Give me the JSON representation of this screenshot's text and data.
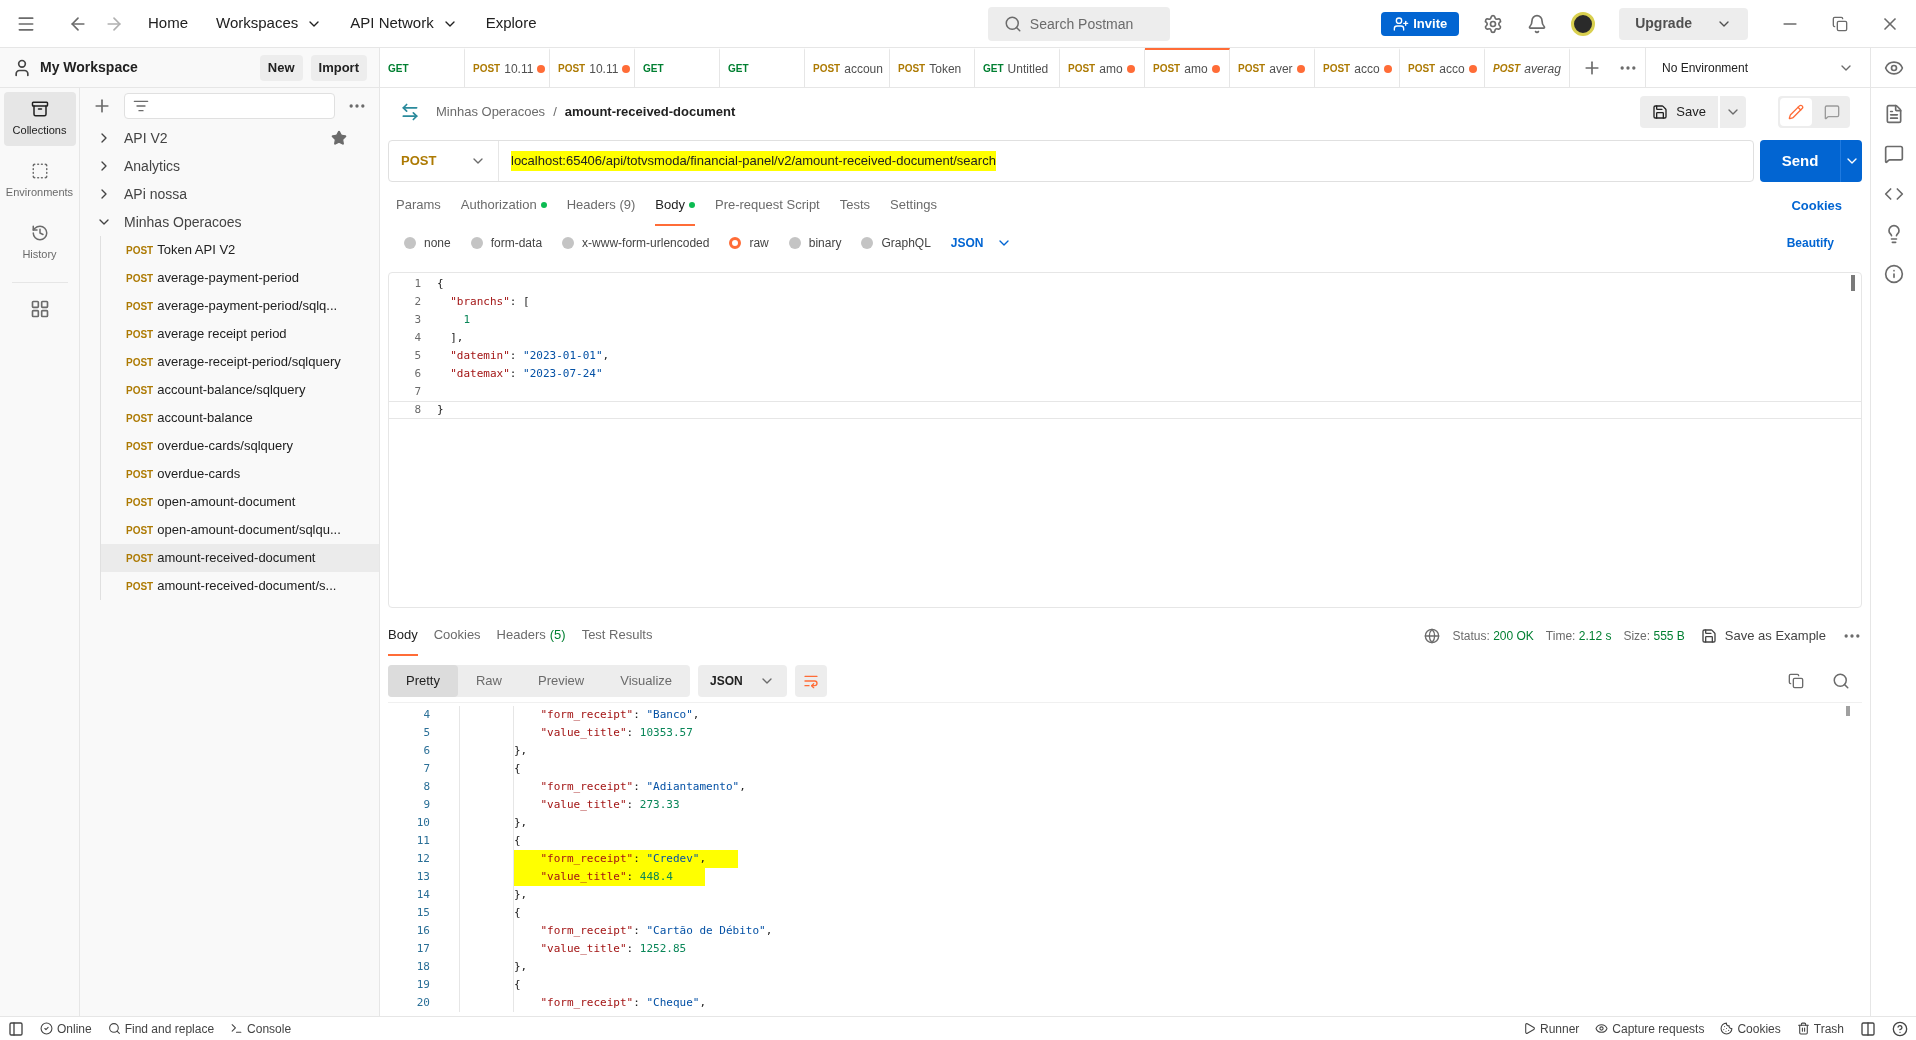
{
  "topbar": {
    "nav": [
      {
        "label": "Home",
        "dropdown": false
      },
      {
        "label": "Workspaces",
        "dropdown": true
      },
      {
        "label": "API Network",
        "dropdown": true
      },
      {
        "label": "Explore",
        "dropdown": false
      }
    ],
    "search": {
      "placeholder": "Search Postman"
    },
    "invite": "Invite",
    "upgrade": "Upgrade"
  },
  "workspace": {
    "title": "My Workspace",
    "buttons": [
      "New",
      "Import"
    ]
  },
  "rail": [
    {
      "label": "Collections",
      "selected": true
    },
    {
      "label": "Environments",
      "selected": false
    },
    {
      "label": "History",
      "selected": false
    }
  ],
  "tree": [
    {
      "name": "API V2",
      "expanded": false,
      "starred": true
    },
    {
      "name": "Analytics",
      "expanded": false,
      "starred": false
    },
    {
      "name": "APi nossa",
      "expanded": false,
      "starred": false
    },
    {
      "name": "Minhas Operacoes",
      "expanded": true,
      "starred": false,
      "children": [
        {
          "method": "POST",
          "name": "Token API V2",
          "selected": false
        },
        {
          "method": "POST",
          "name": "average-payment-period",
          "selected": false
        },
        {
          "method": "POST",
          "name": "average-payment-period/sqlq...",
          "selected": false
        },
        {
          "method": "POST",
          "name": "average receipt period",
          "selected": false
        },
        {
          "method": "POST",
          "name": "average-receipt-period/sqlquery",
          "selected": false
        },
        {
          "method": "POST",
          "name": "account-balance/sqlquery",
          "selected": false
        },
        {
          "method": "POST",
          "name": "account-balance",
          "selected": false
        },
        {
          "method": "POST",
          "name": "overdue-cards/sqlquery",
          "selected": false
        },
        {
          "method": "POST",
          "name": "overdue-cards",
          "selected": false
        },
        {
          "method": "POST",
          "name": "open-amount-document",
          "selected": false
        },
        {
          "method": "POST",
          "name": "open-amount-document/sqlqu...",
          "selected": false
        },
        {
          "method": "POST",
          "name": "amount-received-document",
          "selected": true
        },
        {
          "method": "POST",
          "name": "amount-received-document/s...",
          "selected": false
        }
      ]
    }
  ],
  "tabs": [
    {
      "method": "GET",
      "unsaved": false,
      "selected": false,
      "preview": false
    },
    {
      "method": "POST",
      "name": "10.11",
      "unsaved": true,
      "selected": false,
      "preview": false
    },
    {
      "method": "POST",
      "name": "10.11",
      "unsaved": true,
      "selected": false,
      "preview": false
    },
    {
      "method": "GET",
      "unsaved": false,
      "selected": false,
      "preview": false
    },
    {
      "method": "GET",
      "unsaved": false,
      "selected": false,
      "preview": false
    },
    {
      "method": "POST",
      "name": "accoun",
      "unsaved": false,
      "selected": false,
      "preview": false
    },
    {
      "method": "POST",
      "name": "Token",
      "unsaved": false,
      "selected": false,
      "preview": false
    },
    {
      "method": "GET",
      "name": "Untitled",
      "unsaved": false,
      "selected": false,
      "preview": false
    },
    {
      "method": "POST",
      "name": "amo",
      "unsaved": true,
      "selected": false,
      "preview": false
    },
    {
      "method": "POST",
      "name": "amo",
      "unsaved": true,
      "selected": true,
      "preview": false
    },
    {
      "method": "POST",
      "name": "aver",
      "unsaved": true,
      "selected": false,
      "preview": false
    },
    {
      "method": "POST",
      "name": "acco",
      "unsaved": true,
      "selected": false,
      "preview": false
    },
    {
      "method": "POST",
      "name": "acco",
      "unsaved": true,
      "selected": false,
      "preview": false
    },
    {
      "method": "POST",
      "name": "averag",
      "unsaved": false,
      "selected": false,
      "preview": true
    }
  ],
  "environment": "No Environment",
  "breadcrumb": {
    "parent": "Minhas Operacoes",
    "separator": "/",
    "current": "amount-received-document"
  },
  "save": "Save",
  "modes": [
    {
      "kind": "edit",
      "selected": true
    },
    {
      "kind": "comment",
      "selected": false
    }
  ],
  "request": {
    "method": "POST",
    "url": "localhost:65406/api/totvsmoda/financial-panel/v2/amount-received-document/search",
    "url_highlighted": true,
    "send": "Send"
  },
  "request_tabs": [
    {
      "label": "Params",
      "dot": false,
      "selected": false
    },
    {
      "label": "Authorization",
      "dot": true,
      "selected": false
    },
    {
      "label": "Headers",
      "count": "(9)",
      "dot": false,
      "selected": false
    },
    {
      "label": "Body",
      "dot": true,
      "selected": true
    },
    {
      "label": "Pre-request Script",
      "dot": false,
      "selected": false
    },
    {
      "label": "Tests",
      "dot": false,
      "selected": false
    },
    {
      "label": "Settings",
      "dot": false,
      "selected": false
    }
  ],
  "cookies": "Cookies",
  "body_types": [
    {
      "label": "none",
      "selected": false
    },
    {
      "label": "form-data",
      "selected": false
    },
    {
      "label": "x-www-form-urlencoded",
      "selected": false
    },
    {
      "label": "raw",
      "selected": true
    },
    {
      "label": "binary",
      "selected": false
    },
    {
      "label": "GraphQL",
      "selected": false
    }
  ],
  "body_format": "JSON",
  "beautify": "Beautify",
  "request_body": [
    {
      "n": "1",
      "code": "{",
      "highlighted": false
    },
    {
      "n": "2",
      "code": "  \"branchs\": [",
      "highlighted": false
    },
    {
      "n": "3",
      "code": "    1",
      "highlighted": false
    },
    {
      "n": "4",
      "code": "  ],",
      "highlighted": false
    },
    {
      "n": "5",
      "code": "  \"datemin\": \"2023-01-01\",",
      "highlighted": false
    },
    {
      "n": "6",
      "code": "  \"datemax\": \"2023-07-24\"",
      "highlighted": false
    },
    {
      "n": "7",
      "highlighted": false
    },
    {
      "n": "8",
      "code": "}",
      "highlighted": true
    }
  ],
  "response": {
    "tabs": [
      {
        "label": "Body",
        "selected": true
      },
      {
        "label": "Cookies",
        "selected": false
      },
      {
        "label": "Headers",
        "count": "(5)",
        "selected": false
      },
      {
        "label": "Test Results",
        "selected": false
      }
    ],
    "status_label": "Status:",
    "status": "200 OK",
    "time_label": "Time:",
    "time": "2.12 s",
    "size_label": "Size:",
    "size": "555 B",
    "save_example": "Save as Example",
    "views": [
      {
        "label": "Pretty",
        "selected": true
      },
      {
        "label": "Raw",
        "selected": false
      },
      {
        "label": "Preview",
        "selected": false
      },
      {
        "label": "Visualize",
        "selected": false
      }
    ],
    "format": "JSON",
    "lines": [
      {
        "n": "4",
        "code": "            \"form_receipt\": \"Banco\",",
        "highlighted": false
      },
      {
        "n": "5",
        "code": "            \"value_title\": 10353.57",
        "highlighted": false
      },
      {
        "n": "6",
        "code": "        },",
        "highlighted": false
      },
      {
        "n": "7",
        "code": "        {",
        "highlighted": false
      },
      {
        "n": "8",
        "code": "            \"form_receipt\": \"Adiantamento\",",
        "highlighted": false
      },
      {
        "n": "9",
        "code": "            \"value_title\": 273.33",
        "highlighted": false
      },
      {
        "n": "10",
        "code": "        },",
        "highlighted": false
      },
      {
        "n": "11",
        "code": "        {",
        "highlighted": false
      },
      {
        "n": "12",
        "code": "            \"form_receipt\": \"Credev\",",
        "highlighted": true
      },
      {
        "n": "13",
        "code": "            \"value_title\": 448.4",
        "highlighted": true
      },
      {
        "n": "14",
        "code": "        },",
        "highlighted": false
      },
      {
        "n": "15",
        "code": "        {",
        "highlighted": false
      },
      {
        "n": "16",
        "code": "            \"form_receipt\": \"Cartão de Débito\",",
        "highlighted": false
      },
      {
        "n": "17",
        "code": "            \"value_title\": 1252.85",
        "highlighted": false
      },
      {
        "n": "18",
        "code": "        },",
        "highlighted": false
      },
      {
        "n": "19",
        "code": "        {",
        "highlighted": false
      },
      {
        "n": "20",
        "code": "            \"form_receipt\": \"Cheque\",",
        "highlighted": false
      }
    ]
  },
  "status_bar": {
    "left": [
      "Online",
      "Find and replace",
      "Console"
    ],
    "right": [
      "Runner",
      "Capture requests",
      "Cookies",
      "Trash"
    ]
  }
}
